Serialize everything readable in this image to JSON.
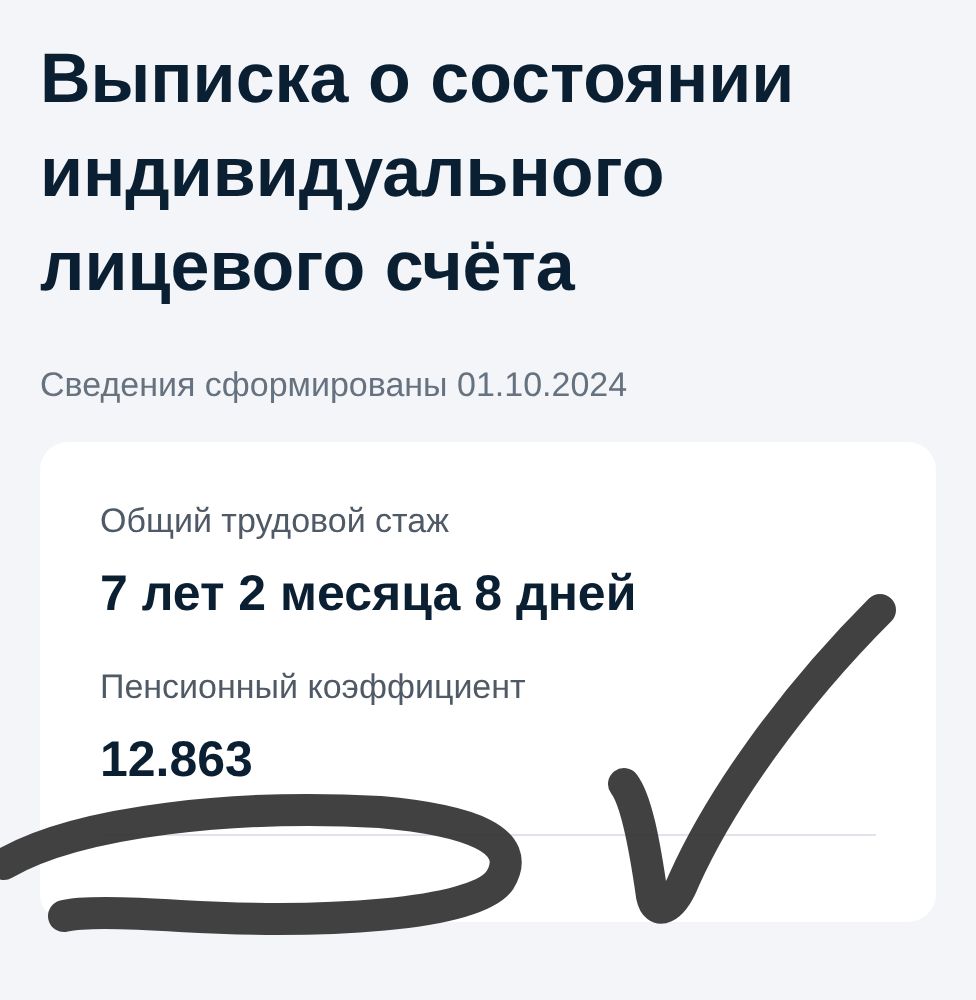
{
  "title": "Выписка о состоянии индивидуального лицевого счёта",
  "subtitle": "Сведения сформированы 01.10.2024",
  "card": {
    "items": [
      {
        "label": "Общий трудовой стаж",
        "value": "7 лет 2 месяца 8 дней"
      },
      {
        "label": "Пенсионный коэффициент",
        "value": "12.863"
      }
    ]
  }
}
